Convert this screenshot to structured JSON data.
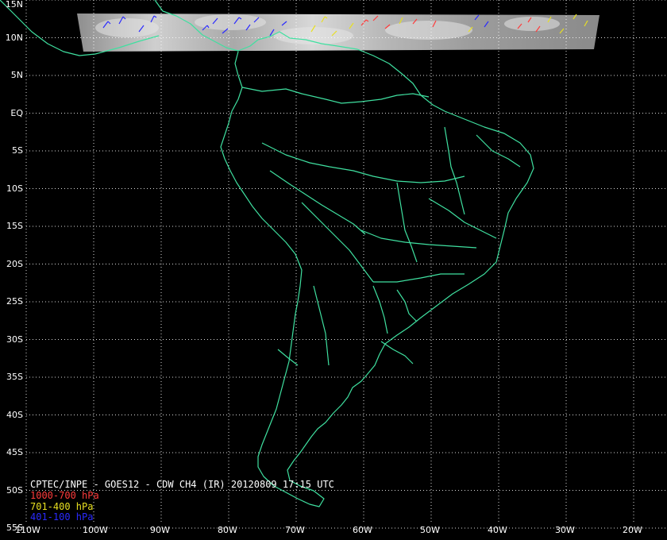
{
  "title": "CPTEC/INPE - GOES12 - CDW CH4 (IR) 20120809 17:15 UTC",
  "legend": [
    {
      "label": "1000-700 hPa",
      "color": "#ff3b3b"
    },
    {
      "label": "701-400 hPa",
      "color": "#e8e020"
    },
    {
      "label": "401-100 hPa",
      "color": "#2a2aff"
    }
  ],
  "lat_labels": [
    "15N",
    "10N",
    "5N",
    "EQ",
    "5S",
    "10S",
    "15S",
    "20S",
    "25S",
    "30S",
    "35S",
    "40S",
    "45S",
    "50S",
    "55S"
  ],
  "lon_labels": [
    "110W",
    "100W",
    "90W",
    "80W",
    "70W",
    "60W",
    "50W",
    "40W",
    "30W",
    "20W"
  ],
  "colors": {
    "background": "#000000",
    "coastline": "#3fe0a0",
    "grid": "#ffffff",
    "imagery_strip": "#9a9a9a"
  }
}
